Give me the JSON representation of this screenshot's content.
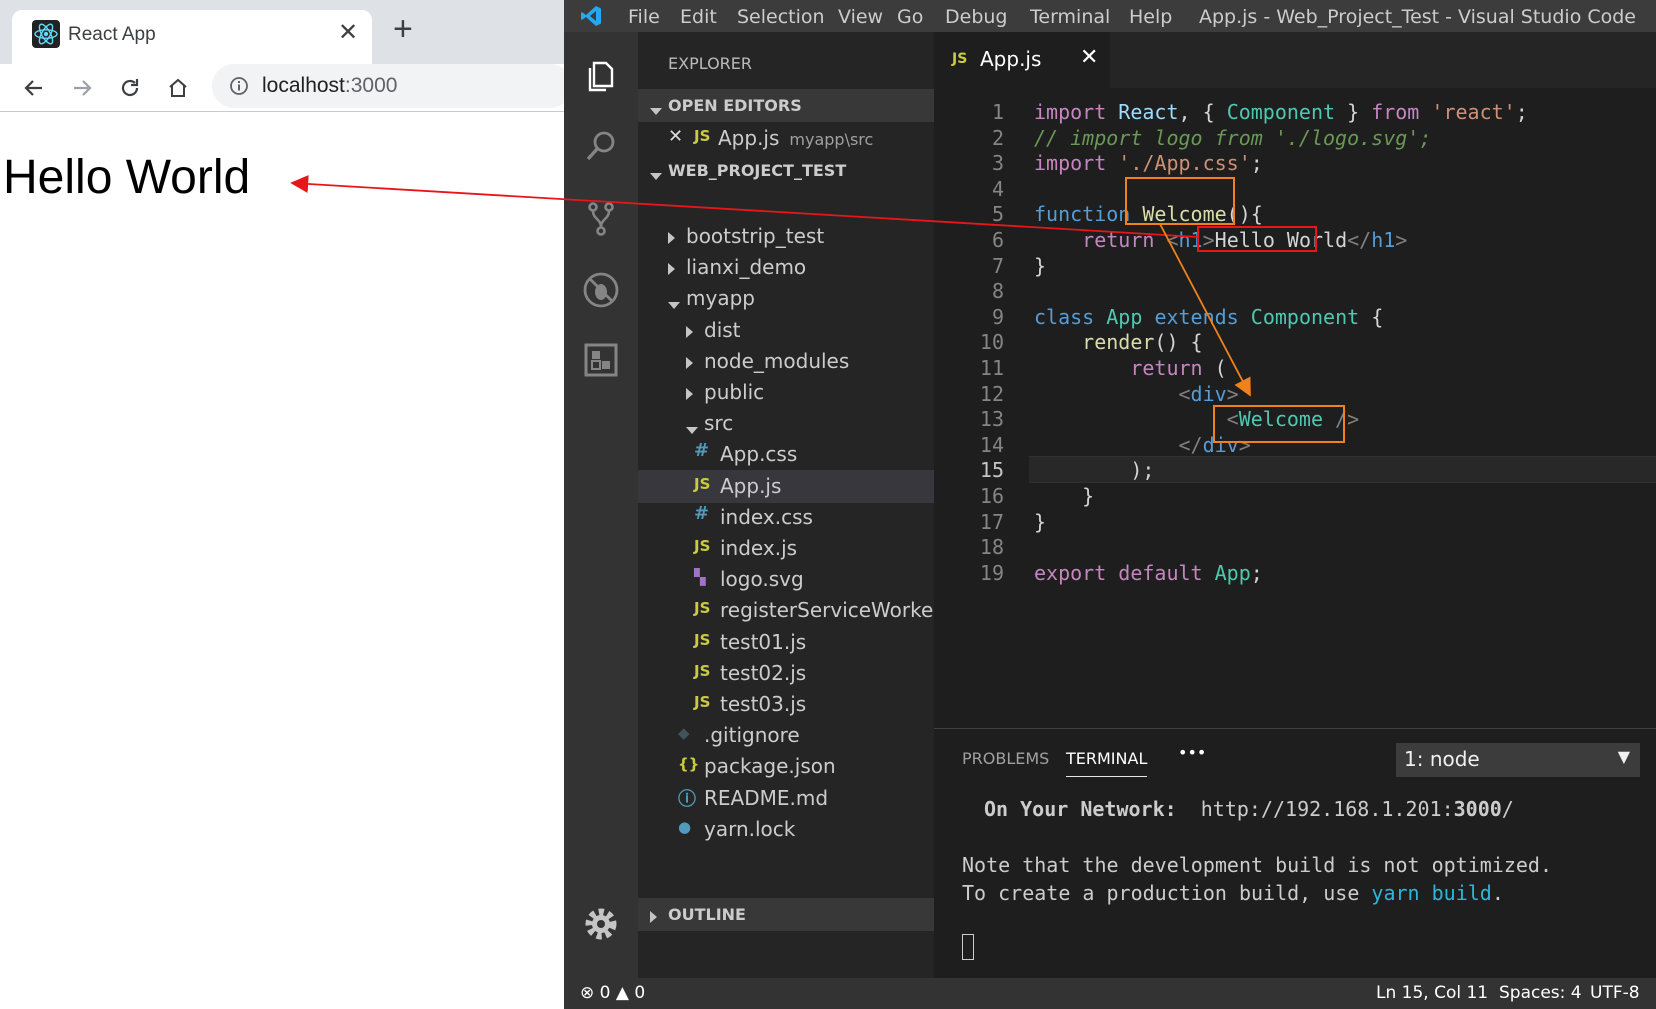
{
  "browser": {
    "tab_title": "React App",
    "url_host": "localhost",
    "url_port": ":3000",
    "page_heading": "Hello World"
  },
  "vscode": {
    "menu": [
      "File",
      "Edit",
      "Selection",
      "View",
      "Go",
      "Debug",
      "Terminal",
      "Help"
    ],
    "window_title": "App.js - Web_Project_Test - Visual Studio Code",
    "explorer_title": "EXPLORER",
    "open_editors_label": "OPEN EDITORS",
    "open_editor": {
      "name": "App.js",
      "path": "myapp\\src",
      "icon": "JS"
    },
    "project_label": "WEB_PROJECT_TEST",
    "outline_label": "OUTLINE",
    "tree": [
      {
        "name": "bootstrip_test",
        "kind": "folder-closed",
        "icon": ""
      },
      {
        "name": "lianxi_demo",
        "kind": "folder-closed",
        "icon": ""
      },
      {
        "name": "myapp",
        "kind": "folder-open",
        "icon": ""
      },
      {
        "name": "dist",
        "kind": "folder-closed",
        "icon": ""
      },
      {
        "name": "node_modules",
        "kind": "folder-closed",
        "icon": ""
      },
      {
        "name": "public",
        "kind": "folder-closed",
        "icon": ""
      },
      {
        "name": "src",
        "kind": "folder-open",
        "icon": ""
      },
      {
        "name": "App.css",
        "kind": "file",
        "icon": "#"
      },
      {
        "name": "App.js",
        "kind": "file",
        "icon": "JS"
      },
      {
        "name": "index.css",
        "kind": "file",
        "icon": "#"
      },
      {
        "name": "index.js",
        "kind": "file",
        "icon": "JS"
      },
      {
        "name": "logo.svg",
        "kind": "file",
        "icon": "svg"
      },
      {
        "name": "registerServiceWorker.js",
        "kind": "file",
        "icon": "JS"
      },
      {
        "name": "test01.js",
        "kind": "file",
        "icon": "JS"
      },
      {
        "name": "test02.js",
        "kind": "file",
        "icon": "JS"
      },
      {
        "name": "test03.js",
        "kind": "file",
        "icon": "JS"
      },
      {
        "name": ".gitignore",
        "kind": "file",
        "icon": "git"
      },
      {
        "name": "package.json",
        "kind": "file",
        "icon": "{}"
      },
      {
        "name": "README.md",
        "kind": "file",
        "icon": "info"
      },
      {
        "name": "yarn.lock",
        "kind": "file",
        "icon": "yarn"
      }
    ],
    "editor_tab": "App.js",
    "editor_tab_icon": "JS",
    "line_numbers": [
      "1",
      "2",
      "3",
      "4",
      "5",
      "6",
      "7",
      "8",
      "9",
      "10",
      "11",
      "12",
      "13",
      "14",
      "15",
      "16",
      "17",
      "18",
      "19"
    ],
    "active_line": "15",
    "code": [
      "import React, { Component } from 'react';",
      "// import logo from './logo.svg';",
      "import './App.css';",
      "",
      "function Welcome(){",
      "    return <h1>Hello World</h1>",
      "}",
      "",
      "class App extends Component {",
      "    render() {",
      "        return (",
      "            <div>",
      "                <Welcome />",
      "            </div>",
      "        );",
      "    }",
      "}",
      "",
      "export default App;"
    ],
    "panel_tabs": [
      "PROBLEMS",
      "TERMINAL"
    ],
    "panel_more": "•••",
    "terminal_select": "1: node",
    "terminal_lines": {
      "network_label": "On Your Network:",
      "network_url": "http://192.168.1.201:",
      "network_port": "3000",
      "network_slash": "/",
      "note": "Note that the development build is not optimized.",
      "create_prefix": "To create a production build, use ",
      "create_cmd": "yarn build",
      "create_suffix": "."
    },
    "status": {
      "errors": "0",
      "warnings": "0",
      "position": "Ln 15, Col 11",
      "spaces": "Spaces: 4",
      "encoding": "UTF-8"
    }
  },
  "colors": {
    "annotation_red": "#e8161b",
    "annotation_orange": "#f0821e",
    "vscode_blue": "#007acc"
  }
}
